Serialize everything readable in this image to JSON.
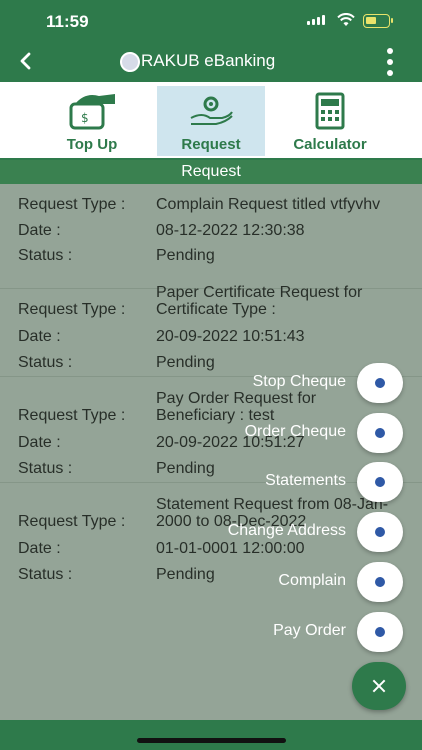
{
  "status_bar": {
    "time": "11:59"
  },
  "app_bar": {
    "title": "RAKUB eBanking"
  },
  "tabs": [
    {
      "label": "Top Up"
    },
    {
      "label": "Request",
      "active": true
    },
    {
      "label": "Calculator"
    }
  ],
  "section": {
    "title": "Request"
  },
  "requests": [
    {
      "type_label": "Request Type :",
      "type_value": "Complain Request titled vtfyvhv",
      "date_label": "Date :",
      "date_value": "08-12-2022 12:30:38",
      "status_label": "Status :",
      "status_value": "Pending"
    },
    {
      "type_label": "Request Type :",
      "type_value": "Paper Certificate Request for Certificate Type :",
      "date_label": "Date :",
      "date_value": "20-09-2022 10:51:43",
      "status_label": "Status :",
      "status_value": "Pending"
    },
    {
      "type_label": "Request Type :",
      "type_value": "Pay Order Request for Beneficiary : test",
      "date_label": "Date :",
      "date_value": "20-09-2022 10:51:27",
      "status_label": "Status :",
      "status_value": "Pending"
    },
    {
      "type_label": "Request Type :",
      "type_value": "Statement Request from 08-Jan-2000 to 08-Dec-2022",
      "date_label": "Date :",
      "date_value": "01-01-0001 12:00:00",
      "status_label": "Status :",
      "status_value": "Pending"
    }
  ],
  "fab_menu": [
    {
      "label": "Stop Cheque"
    },
    {
      "label": "Order Cheque"
    },
    {
      "label": "Statements"
    },
    {
      "label": "Change Address"
    },
    {
      "label": "Complain"
    },
    {
      "label": "Pay Order"
    }
  ],
  "colors": {
    "primary": "#2e7a4b",
    "active_tab": "#cfe5ee",
    "fab_dot": "#2f59a6"
  }
}
